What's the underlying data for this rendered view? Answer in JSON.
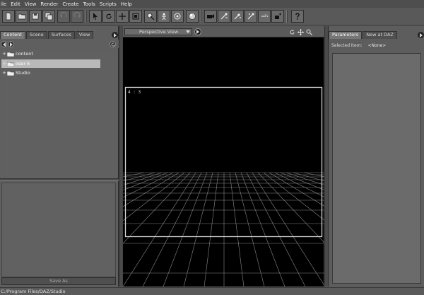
{
  "menu": [
    {
      "label": "ile",
      "u": "F"
    },
    {
      "label": "Edit",
      "u": "E"
    },
    {
      "label": "View",
      "u": "V"
    },
    {
      "label": "Render",
      "u": "R"
    },
    {
      "label": "Create",
      "u": "C"
    },
    {
      "label": "Tools",
      "u": "T"
    },
    {
      "label": "Scripts",
      "u": "S"
    },
    {
      "label": "Help",
      "u": "H"
    }
  ],
  "toolbar": {
    "icons": [
      "new-file-icon",
      "open-file-icon",
      "save-icon",
      "save-as-icon",
      "undo-icon",
      "redo-icon",
      "pointer-icon",
      "rotate-icon",
      "translate-icon",
      "scale-icon",
      "node-select-icon",
      "active-pose-icon",
      "joint-editor-icon",
      "sphere-icon",
      "camera-icon",
      "figure-setup-icon",
      "surface-selection-icon",
      "geometry-editor-icon",
      "light-icon",
      "node-add-icon",
      "help-icon"
    ]
  },
  "left_panel": {
    "tabs": [
      "Content",
      "Scene",
      "Surfaces",
      "View"
    ],
    "active_tab": "Content",
    "tree": [
      {
        "label": "content",
        "selected": false
      },
      {
        "label": "oser 6",
        "selected": true
      },
      {
        "label": "Studio",
        "selected": false
      }
    ],
    "save_as_label": "Save As"
  },
  "viewport": {
    "view_label": "Perspective View",
    "aspect_label": "4 : 3"
  },
  "right_panel": {
    "tabs": [
      "Parameters",
      "New at DAZ"
    ],
    "active_tab": "Parameters",
    "selected_item_label": "Selected Item:",
    "selected_item_value": "<None>"
  },
  "status": {
    "path": "C:/Program Files/DAZ/Studio"
  },
  "colors": {
    "background": "#5a5a5a",
    "viewport_bg": "#000000",
    "grid_line": "#8a8a8a",
    "tree_selected": "#b9b9b9"
  }
}
